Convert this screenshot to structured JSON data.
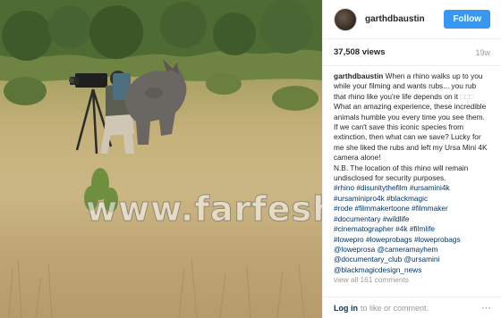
{
  "post": {
    "photo_alt_icon": "photo",
    "watermark": "www.farfesh.com"
  },
  "header": {
    "username": "garthdbaustin",
    "follow_label": "Follow",
    "follow_color": "#3897f0"
  },
  "stats": {
    "likes": "37,508 views",
    "age": "19w"
  },
  "caption": {
    "author": "garthdbaustin",
    "text_1": "When a rhino walks up to you while your filming and wants rubs... you rub that rhino like you're life depends on it",
    "text_2": "What an amazing experience, these incredible animals humble you every time you see them. If we can't save this iconic species from extinction, then what can we save? Lucky for me she liked the rubs and left my Ursa Mini 4K camera alone!",
    "text_3": "N.B. The location of this rhino will remain undisclosed for security purposes.",
    "tags_line_1": "#rhino #disunitythefilm #ursamini4k",
    "tags_line_2": "#ursaminipro4k #blackmagic",
    "tags_line_3": "#rode #filmmakertoone #filmmaker",
    "tags_line_4": "#documentary #wildlife",
    "tags_line_5": "#cinematographer #4k #filmlife",
    "tags_line_6": "#lowepro #loweprobags #loweprobags",
    "tags_line_7": "@loweprosa @cameramayhem",
    "tags_line_8": "@documentary_club @ursamini",
    "tags_line_9": "@blackmagicdesign_news",
    "view_all": "view all 161 comments"
  },
  "footer": {
    "login_label": "Log in",
    "rest": "to like or comment.",
    "more_icon": "more-icon"
  }
}
